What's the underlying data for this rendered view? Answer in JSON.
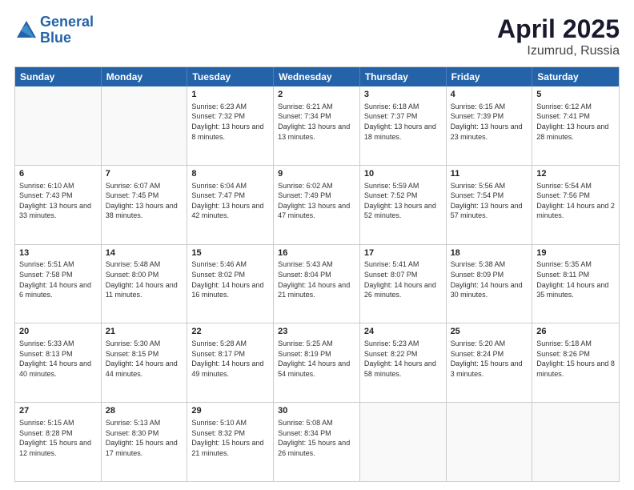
{
  "header": {
    "logo_line1": "General",
    "logo_line2": "Blue",
    "title": "April 2025",
    "subtitle": "Izumrud, Russia"
  },
  "calendar": {
    "days_of_week": [
      "Sunday",
      "Monday",
      "Tuesday",
      "Wednesday",
      "Thursday",
      "Friday",
      "Saturday"
    ],
    "weeks": [
      [
        {
          "day": "",
          "empty": true
        },
        {
          "day": "",
          "empty": true
        },
        {
          "day": "1",
          "sunrise": "Sunrise: 6:23 AM",
          "sunset": "Sunset: 7:32 PM",
          "daylight": "Daylight: 13 hours and 8 minutes."
        },
        {
          "day": "2",
          "sunrise": "Sunrise: 6:21 AM",
          "sunset": "Sunset: 7:34 PM",
          "daylight": "Daylight: 13 hours and 13 minutes."
        },
        {
          "day": "3",
          "sunrise": "Sunrise: 6:18 AM",
          "sunset": "Sunset: 7:37 PM",
          "daylight": "Daylight: 13 hours and 18 minutes."
        },
        {
          "day": "4",
          "sunrise": "Sunrise: 6:15 AM",
          "sunset": "Sunset: 7:39 PM",
          "daylight": "Daylight: 13 hours and 23 minutes."
        },
        {
          "day": "5",
          "sunrise": "Sunrise: 6:12 AM",
          "sunset": "Sunset: 7:41 PM",
          "daylight": "Daylight: 13 hours and 28 minutes."
        }
      ],
      [
        {
          "day": "6",
          "sunrise": "Sunrise: 6:10 AM",
          "sunset": "Sunset: 7:43 PM",
          "daylight": "Daylight: 13 hours and 33 minutes."
        },
        {
          "day": "7",
          "sunrise": "Sunrise: 6:07 AM",
          "sunset": "Sunset: 7:45 PM",
          "daylight": "Daylight: 13 hours and 38 minutes."
        },
        {
          "day": "8",
          "sunrise": "Sunrise: 6:04 AM",
          "sunset": "Sunset: 7:47 PM",
          "daylight": "Daylight: 13 hours and 42 minutes."
        },
        {
          "day": "9",
          "sunrise": "Sunrise: 6:02 AM",
          "sunset": "Sunset: 7:49 PM",
          "daylight": "Daylight: 13 hours and 47 minutes."
        },
        {
          "day": "10",
          "sunrise": "Sunrise: 5:59 AM",
          "sunset": "Sunset: 7:52 PM",
          "daylight": "Daylight: 13 hours and 52 minutes."
        },
        {
          "day": "11",
          "sunrise": "Sunrise: 5:56 AM",
          "sunset": "Sunset: 7:54 PM",
          "daylight": "Daylight: 13 hours and 57 minutes."
        },
        {
          "day": "12",
          "sunrise": "Sunrise: 5:54 AM",
          "sunset": "Sunset: 7:56 PM",
          "daylight": "Daylight: 14 hours and 2 minutes."
        }
      ],
      [
        {
          "day": "13",
          "sunrise": "Sunrise: 5:51 AM",
          "sunset": "Sunset: 7:58 PM",
          "daylight": "Daylight: 14 hours and 6 minutes."
        },
        {
          "day": "14",
          "sunrise": "Sunrise: 5:48 AM",
          "sunset": "Sunset: 8:00 PM",
          "daylight": "Daylight: 14 hours and 11 minutes."
        },
        {
          "day": "15",
          "sunrise": "Sunrise: 5:46 AM",
          "sunset": "Sunset: 8:02 PM",
          "daylight": "Daylight: 14 hours and 16 minutes."
        },
        {
          "day": "16",
          "sunrise": "Sunrise: 5:43 AM",
          "sunset": "Sunset: 8:04 PM",
          "daylight": "Daylight: 14 hours and 21 minutes."
        },
        {
          "day": "17",
          "sunrise": "Sunrise: 5:41 AM",
          "sunset": "Sunset: 8:07 PM",
          "daylight": "Daylight: 14 hours and 26 minutes."
        },
        {
          "day": "18",
          "sunrise": "Sunrise: 5:38 AM",
          "sunset": "Sunset: 8:09 PM",
          "daylight": "Daylight: 14 hours and 30 minutes."
        },
        {
          "day": "19",
          "sunrise": "Sunrise: 5:35 AM",
          "sunset": "Sunset: 8:11 PM",
          "daylight": "Daylight: 14 hours and 35 minutes."
        }
      ],
      [
        {
          "day": "20",
          "sunrise": "Sunrise: 5:33 AM",
          "sunset": "Sunset: 8:13 PM",
          "daylight": "Daylight: 14 hours and 40 minutes."
        },
        {
          "day": "21",
          "sunrise": "Sunrise: 5:30 AM",
          "sunset": "Sunset: 8:15 PM",
          "daylight": "Daylight: 14 hours and 44 minutes."
        },
        {
          "day": "22",
          "sunrise": "Sunrise: 5:28 AM",
          "sunset": "Sunset: 8:17 PM",
          "daylight": "Daylight: 14 hours and 49 minutes."
        },
        {
          "day": "23",
          "sunrise": "Sunrise: 5:25 AM",
          "sunset": "Sunset: 8:19 PM",
          "daylight": "Daylight: 14 hours and 54 minutes."
        },
        {
          "day": "24",
          "sunrise": "Sunrise: 5:23 AM",
          "sunset": "Sunset: 8:22 PM",
          "daylight": "Daylight: 14 hours and 58 minutes."
        },
        {
          "day": "25",
          "sunrise": "Sunrise: 5:20 AM",
          "sunset": "Sunset: 8:24 PM",
          "daylight": "Daylight: 15 hours and 3 minutes."
        },
        {
          "day": "26",
          "sunrise": "Sunrise: 5:18 AM",
          "sunset": "Sunset: 8:26 PM",
          "daylight": "Daylight: 15 hours and 8 minutes."
        }
      ],
      [
        {
          "day": "27",
          "sunrise": "Sunrise: 5:15 AM",
          "sunset": "Sunset: 8:28 PM",
          "daylight": "Daylight: 15 hours and 12 minutes."
        },
        {
          "day": "28",
          "sunrise": "Sunrise: 5:13 AM",
          "sunset": "Sunset: 8:30 PM",
          "daylight": "Daylight: 15 hours and 17 minutes."
        },
        {
          "day": "29",
          "sunrise": "Sunrise: 5:10 AM",
          "sunset": "Sunset: 8:32 PM",
          "daylight": "Daylight: 15 hours and 21 minutes."
        },
        {
          "day": "30",
          "sunrise": "Sunrise: 5:08 AM",
          "sunset": "Sunset: 8:34 PM",
          "daylight": "Daylight: 15 hours and 26 minutes."
        },
        {
          "day": "",
          "empty": true
        },
        {
          "day": "",
          "empty": true
        },
        {
          "day": "",
          "empty": true
        }
      ]
    ]
  }
}
